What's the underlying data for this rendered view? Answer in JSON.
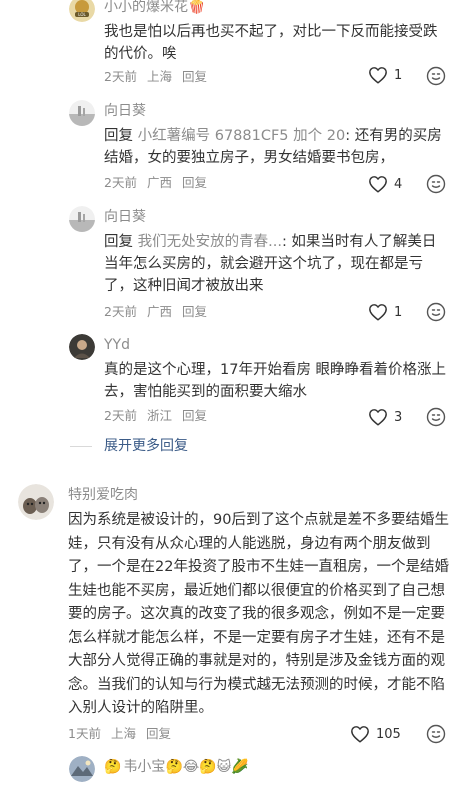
{
  "replies": [
    {
      "username": "小小的爆米花",
      "name_emoji": "🍿",
      "text": "我也是怕以后再也买不起了，对比一下反而能接受跌的代价。唉",
      "time": "2天前",
      "location": "上海",
      "reply_label": "回复",
      "likes": "1"
    },
    {
      "username": "向日葵",
      "prefix": "回复",
      "mention": "小红薯编号 67881CF5 加个 20",
      "text": ": 还有男的买房结婚，女的要独立房子，男女结婚要书包房，",
      "time": "2天前",
      "location": "广西",
      "reply_label": "回复",
      "likes": "4"
    },
    {
      "username": "向日葵",
      "prefix": "回复",
      "mention": "我们无处安放的青春...",
      "text": ": 如果当时有人了解美日当年怎么买房的，就会避开这个坑了，现在都是亏了，这种旧闻才被放出来",
      "time": "2天前",
      "location": "广西",
      "reply_label": "回复",
      "likes": "1"
    },
    {
      "username": "YYd",
      "text": "真的是这个心理，17年开始看房 眼睁睁看着价格涨上去，害怕能买到的面积要大缩水",
      "time": "2天前",
      "location": "浙江",
      "reply_label": "回复",
      "likes": "3"
    }
  ],
  "expand_more": "展开更多回复",
  "comment": {
    "username": "特别爱吃肉",
    "text": "因为系统是被设计的，90后到了这个点就是差不多要结婚生娃，只有没有从众心理的人能逃脱，身边有两个朋友做到了，一个是在22年投资了股市不生娃一直租房，一个是结婚生娃也能不买房，最近她们都以很便宜的价格买到了自己想要的房子。这次真的改变了我的很多观念，例如不是一定要怎么样就才能怎么样，不是一定要有房子才生娃，还有不是大部分人觉得正确的事就是对的，特别是涉及金钱方面的观念。当我们的认知与行为模式越无法预测的时候，才能不陷入别人设计的陷阱里。",
    "time": "1天前",
    "location": "上海",
    "reply_label": "回复",
    "likes": "105"
  },
  "next_comment": {
    "username": "韦小宝",
    "emojis": "🤔😂🤔😺🌽"
  },
  "icons": {
    "like": "heart-outline-icon",
    "emoji": "smiley-face-icon"
  },
  "colors": {
    "link": "#3b5b87",
    "meta": "#8c8c8c",
    "text": "#333333"
  }
}
